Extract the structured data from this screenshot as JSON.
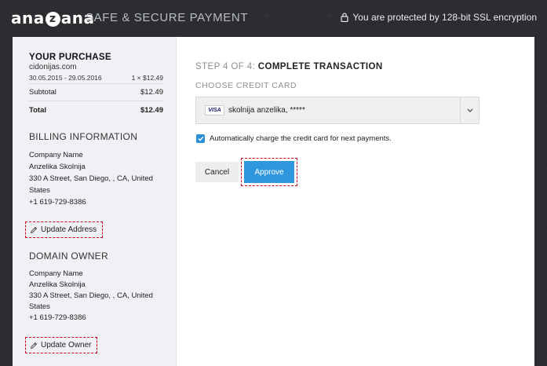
{
  "header": {
    "logo_text": "anazana",
    "tagline": "SAFE & SECURE PAYMENT",
    "ssl_text": "You are protected by 128-bit SSL encryption"
  },
  "purchase": {
    "title": "YOUR PURCHASE",
    "domain": "cidonijas.com",
    "dates": "30.05.2015 - 29.05.2016",
    "qty_price": "1 × $12.49",
    "subtotal_label": "Subtotal",
    "subtotal_value": "$12.49",
    "total_label": "Total",
    "total_value": "$12.49"
  },
  "billing": {
    "title": "BILLING INFORMATION",
    "company": "Company Name",
    "name": "Anzelika Skolnija",
    "address": "330 A Street, San Diego, , CA, United States",
    "phone": "+1 619-729-8386",
    "update_label": "Update Address"
  },
  "owner": {
    "title": "DOMAIN OWNER",
    "company": "Company Name",
    "name": "Anzelika Skolnija",
    "address": "330 A Street, San Diego, , CA, United States",
    "phone": "+1 619-729-8386",
    "update_label": "Update Owner"
  },
  "main": {
    "step_prefix": "STEP 4 OF 4:",
    "step_title": "COMPLETE TRANSACTION",
    "choose_label": "CHOOSE CREDIT CARD",
    "card_brand": "VISA",
    "card_value": "skolnija anzelika, *****",
    "auto_charge_label": "Automatically charge the credit card for next payments.",
    "auto_charge_checked": true,
    "cancel_label": "Cancel",
    "approve_label": "Approve"
  },
  "colors": {
    "accent": "#2f97dd",
    "highlight_dashed": "#d0021b",
    "background": "#2b2d30"
  }
}
